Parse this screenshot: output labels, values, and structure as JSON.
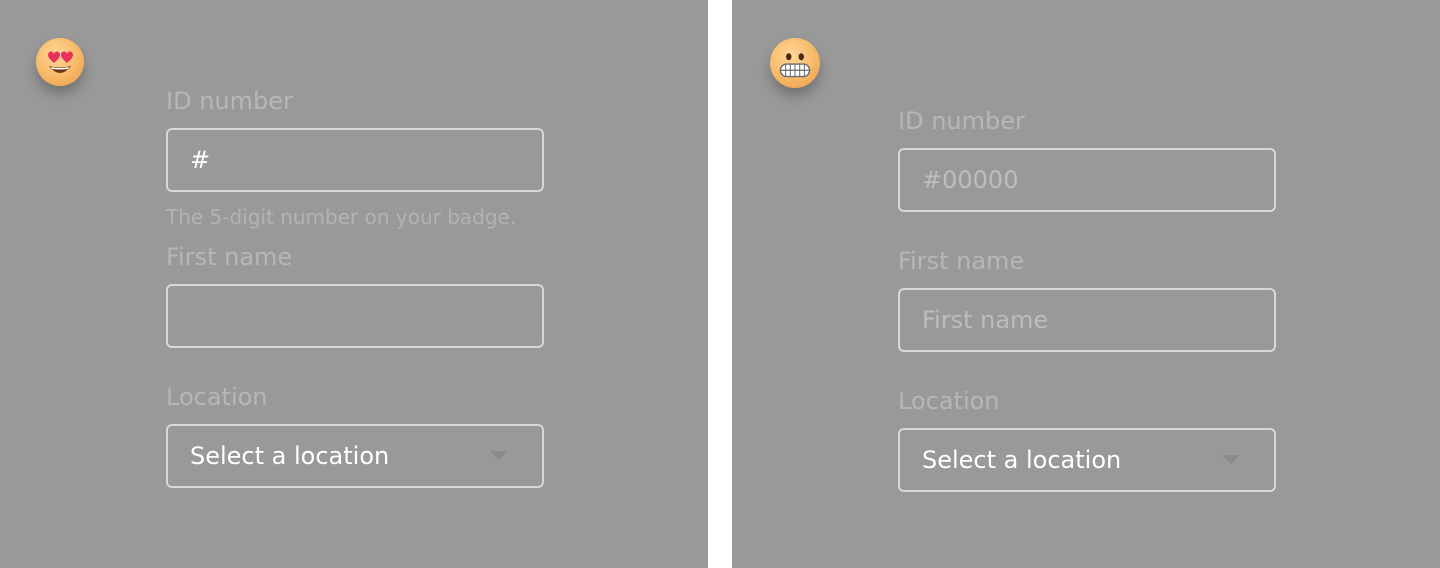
{
  "variants": [
    {
      "emoji": "heart-eyes-face-icon",
      "id_field": {
        "label": "ID number",
        "value": "#",
        "placeholder": "",
        "help": "The 5-digit number on your badge."
      },
      "first_name_field": {
        "label": "First name",
        "value": "",
        "placeholder": ""
      },
      "location_field": {
        "label": "Location",
        "selected": "Select a location"
      }
    },
    {
      "emoji": "grimacing-face-icon",
      "id_field": {
        "label": "ID number",
        "value": "",
        "placeholder": "#00000"
      },
      "first_name_field": {
        "label": "First name",
        "value": "",
        "placeholder": "First name"
      },
      "location_field": {
        "label": "Location",
        "selected": "Select a location"
      }
    }
  ],
  "colors": {
    "panel_background": "#999999",
    "divider": "#ffffff",
    "field_border": "#d8d8d8",
    "label_text": "#b7b7b7",
    "value_text": "#ffffff"
  }
}
